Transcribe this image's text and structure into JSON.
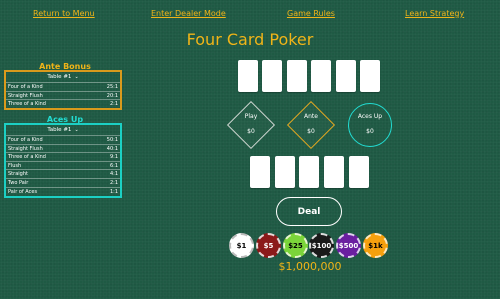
{
  "nav": {
    "return": "Return to Menu",
    "dealer": "Enter Dealer Mode",
    "rules": "Game Rules",
    "strategy": "Learn Strategy"
  },
  "title": "Four Card Poker",
  "ante_bonus": {
    "title": "Ante Bonus",
    "table": "Table #1",
    "rows": [
      {
        "hand": "Four of a Kind",
        "pay": "25:1"
      },
      {
        "hand": "Straight Flush",
        "pay": "20:1"
      },
      {
        "hand": "Three of a Kind",
        "pay": "2:1"
      }
    ]
  },
  "aces_up": {
    "title": "Aces Up",
    "table": "Table #1",
    "rows": [
      {
        "hand": "Four of a Kind",
        "pay": "50:1"
      },
      {
        "hand": "Straight Flush",
        "pay": "40:1"
      },
      {
        "hand": "Three of a Kind",
        "pay": "9:1"
      },
      {
        "hand": "Flush",
        "pay": "6:1"
      },
      {
        "hand": "Straight",
        "pay": "4:1"
      },
      {
        "hand": "Two Pair",
        "pay": "2:1"
      },
      {
        "hand": "Pair of Aces",
        "pay": "1:1"
      }
    ]
  },
  "spots": {
    "play": {
      "label": "Play",
      "amount": "$0"
    },
    "ante": {
      "label": "Ante",
      "amount": "$0"
    },
    "aces_up": {
      "label": "Aces Up",
      "amount": "$0"
    }
  },
  "deal_label": "Deal",
  "chips": [
    {
      "label": "$1",
      "color": "#ffffff",
      "text": "#000000"
    },
    {
      "label": "$5",
      "color": "#8b1a1a",
      "text": "#ffffff"
    },
    {
      "label": "$25",
      "color": "#7bd43a",
      "text": "#000000"
    },
    {
      "label": "$100",
      "color": "#1a1a1a",
      "text": "#ffffff"
    },
    {
      "label": "$500",
      "color": "#6a1fa0",
      "text": "#ffffff"
    },
    {
      "label": "$1k",
      "color": "#f5a00e",
      "text": "#000000"
    }
  ],
  "bankroll": "$1,000,000"
}
